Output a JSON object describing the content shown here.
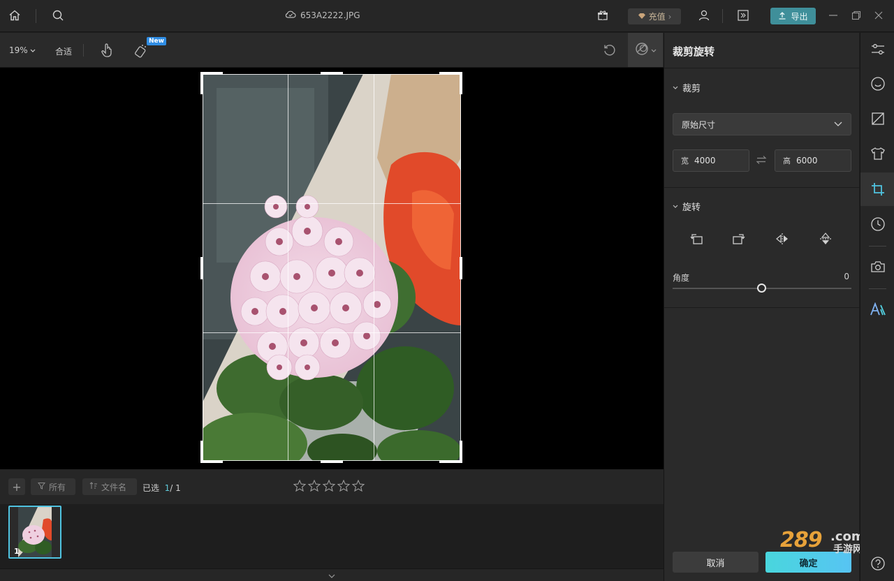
{
  "titlebar": {
    "file_name": "653A2222.JPG",
    "recharge_label": "充值",
    "export_label": "导出"
  },
  "toolbar": {
    "zoom_label": "19%",
    "fit_label": "合适",
    "new_badge": "New"
  },
  "filmstrip": {
    "filter_all_label": "所有",
    "sort_label": "文件名",
    "selected_label": "已选",
    "selected_count": "1",
    "selected_total": "/ 1",
    "rating_stars": 0,
    "thumb_index": "1"
  },
  "panel": {
    "title": "裁剪旋转",
    "crop_section": "裁剪",
    "aspect_option": "原始尺寸",
    "width_label": "宽",
    "width_value": "4000",
    "height_label": "高",
    "height_value": "6000",
    "rotate_section": "旋转",
    "angle_label": "角度",
    "angle_value": "0",
    "cancel_label": "取消",
    "confirm_label": "确定"
  },
  "watermark": {
    "text_main": "289",
    "text_com": ".com",
    "text_sub": "手游网"
  },
  "colors": {
    "accent": "#4fc3e0",
    "export_button": "#3f8f9a",
    "confirm_gradient_start": "#49d6dd",
    "confirm_gradient_end": "#57c4f3",
    "new_badge": "#2f8de4"
  },
  "icons": {
    "titlebar": [
      "home-icon",
      "search-icon",
      "cloud-icon",
      "gift-icon",
      "diamond-icon",
      "user-icon",
      "collapse-panel-icon",
      "upload-icon",
      "minimize-icon",
      "restore-icon",
      "close-icon"
    ],
    "toolbar": [
      "hand-tool-icon",
      "ai-eraser-icon",
      "undo-icon",
      "compare-icon"
    ],
    "rail": [
      "adjust-sliders-icon",
      "face-icon",
      "tone-curve-icon",
      "clothing-icon",
      "crop-icon",
      "history-icon",
      "camera-icon",
      "ai-icon",
      "help-icon"
    ]
  }
}
